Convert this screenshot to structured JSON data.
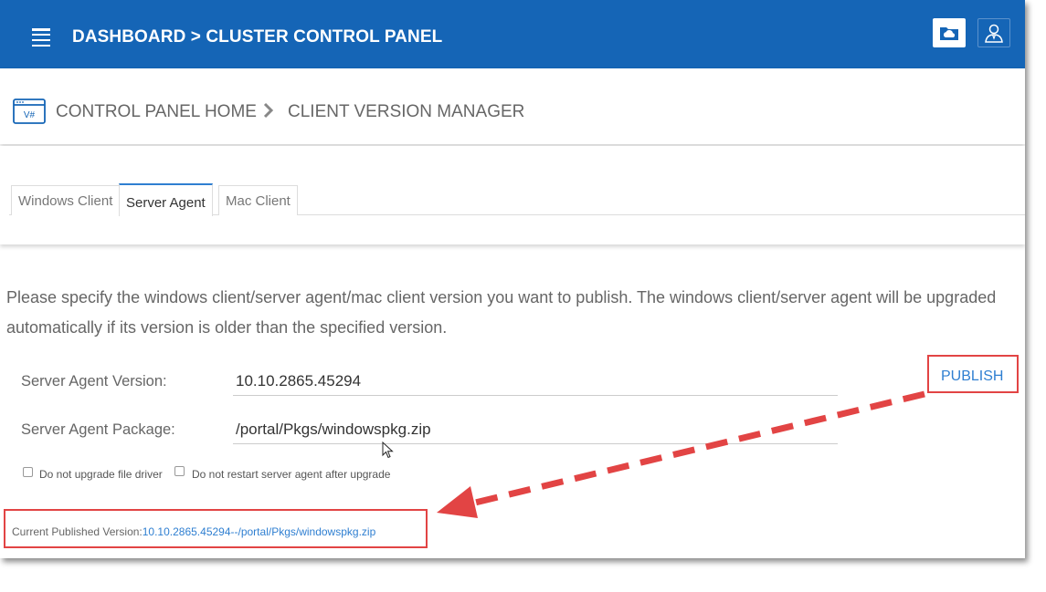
{
  "header": {
    "title": "DASHBOARD > CLUSTER CONTROL PANEL",
    "buttons": [
      "cloud-folder-icon",
      "user-profile-icon"
    ],
    "color": "#1565b6"
  },
  "breadcrumb": {
    "icon_text": "V#",
    "home": "CONTROL PANEL HOME",
    "current": "CLIENT VERSION MANAGER"
  },
  "tabs": [
    {
      "label": "Windows Client",
      "active": false
    },
    {
      "label": "Server Agent",
      "active": true
    },
    {
      "label": "Mac Client",
      "active": false
    }
  ],
  "description": "Please specify the windows client/server agent/mac client version you want to publish. The windows client/server agent will be upgraded automatically if its version is older than the specified version.",
  "form": {
    "version_label": "Server Agent Version:",
    "version_value": "10.10.2865.45294",
    "package_label": "Server Agent Package:",
    "package_value": "/portal/Pkgs/windowspkg.zip",
    "publish_label": "PUBLISH",
    "checkbox1_label": "Do not upgrade file driver",
    "checkbox1_checked": false,
    "checkbox2_label": "Do not restart server agent after upgrade",
    "checkbox2_checked": false
  },
  "current": {
    "label": "Current Published Version:",
    "value": "10.10.2865.45294--/portal/Pkgs/windowspkg.zip"
  },
  "annotation_color": "#e24444"
}
